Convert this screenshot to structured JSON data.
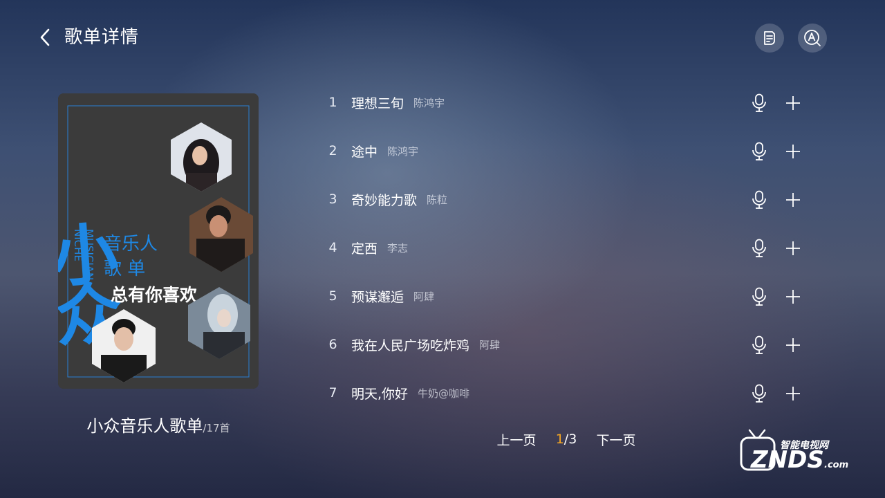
{
  "header": {
    "title": "歌单详情",
    "back_icon": "chevron-left-icon",
    "list_icon": "playlist-icon",
    "search_icon": "search-letter-icon"
  },
  "cover": {
    "big_title": "小众",
    "side_text_1": "NICHE",
    "side_text_2": "MUSICIAN",
    "line1": "音乐人",
    "line2": "歌 单",
    "slogan": "总有你喜欢",
    "accent_color": "#1e88e5"
  },
  "playlist": {
    "name": "小众音乐人歌单",
    "count": "/17首"
  },
  "songs": [
    {
      "index": "1",
      "title": "理想三旬",
      "artist": "陈鸿宇"
    },
    {
      "index": "2",
      "title": "途中",
      "artist": "陈鸿宇"
    },
    {
      "index": "3",
      "title": "奇妙能力歌",
      "artist": "陈粒"
    },
    {
      "index": "4",
      "title": "定西",
      "artist": "李志"
    },
    {
      "index": "5",
      "title": "预谋邂逅",
      "artist": "阿肆"
    },
    {
      "index": "6",
      "title": "我在人民广场吃炸鸡",
      "artist": "阿肆"
    },
    {
      "index": "7",
      "title": "明天,你好",
      "artist": "牛奶@咖啡"
    }
  ],
  "pager": {
    "prev": "上一页",
    "current": "1",
    "total": "/3",
    "next": "下一页"
  },
  "watermark": {
    "cn": "智能电视网",
    "en": "ZNDS",
    "suffix": ".com"
  }
}
